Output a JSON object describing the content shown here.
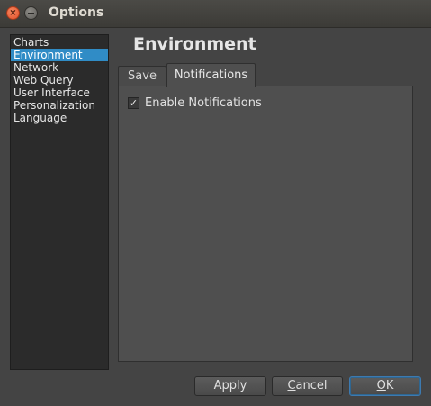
{
  "window": {
    "title": "Options",
    "close_icon": "×"
  },
  "sidebar": {
    "items": [
      {
        "label": "Charts",
        "selected": false
      },
      {
        "label": "Environment",
        "selected": true
      },
      {
        "label": "Network",
        "selected": false
      },
      {
        "label": "Web Query",
        "selected": false
      },
      {
        "label": "User Interface",
        "selected": false
      },
      {
        "label": "Personalization",
        "selected": false
      },
      {
        "label": "Language",
        "selected": false
      }
    ]
  },
  "main": {
    "title": "Environment",
    "tabs": [
      {
        "label": "Save",
        "active": false
      },
      {
        "label": "Notifications",
        "active": true
      }
    ],
    "notifications": {
      "enable_label": "Enable Notifications",
      "enable_checked": true,
      "check_mark": "✓"
    }
  },
  "footer": {
    "apply_label": "Apply",
    "cancel_mnemonic": "C",
    "cancel_rest": "ancel",
    "ok_mnemonic": "O",
    "ok_rest": "K"
  },
  "colors": {
    "selection": "#308cc6",
    "window_bg": "#444444",
    "sidebar_bg": "#2b2b2b"
  }
}
